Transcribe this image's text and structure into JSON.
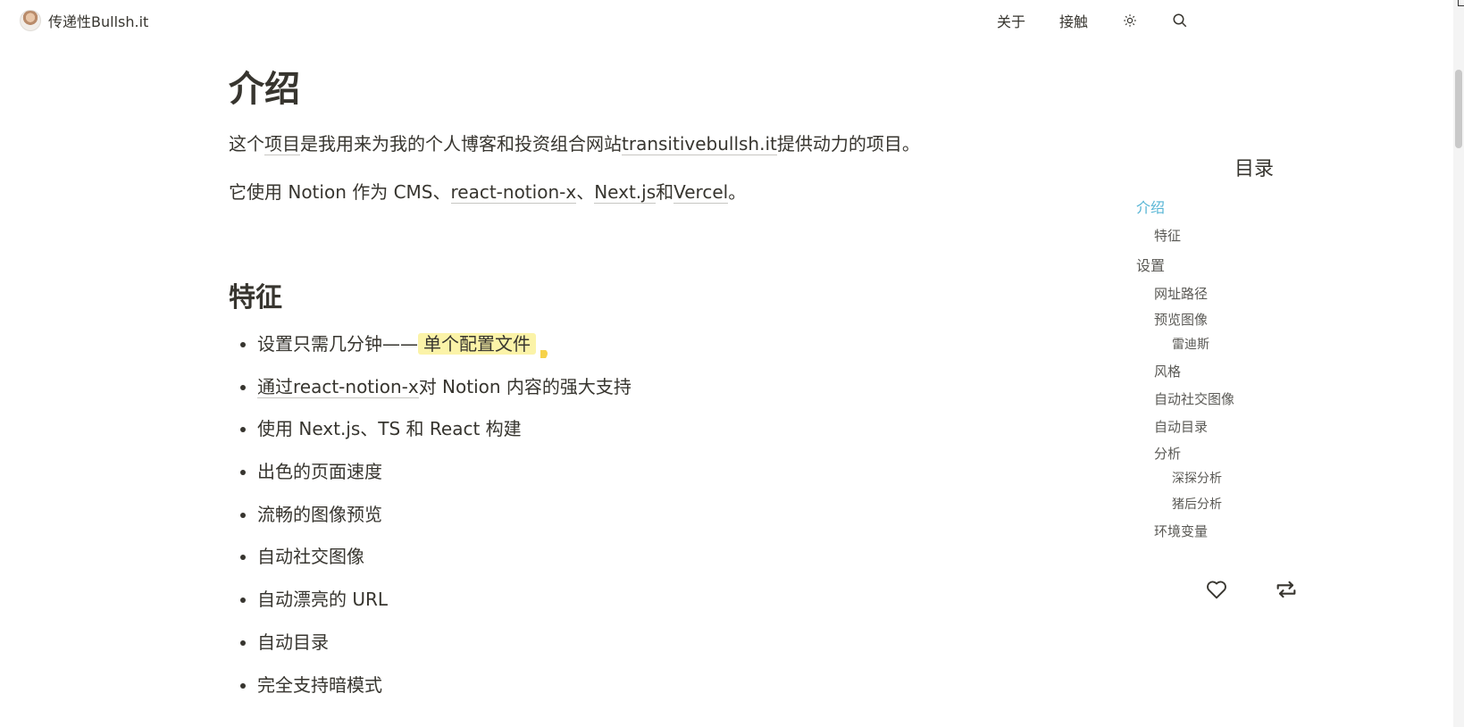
{
  "header": {
    "site_title": "传递性Bullsh.it",
    "nav": [
      {
        "label": "关于"
      },
      {
        "label": "接触"
      }
    ],
    "icons": {
      "theme": "sun-icon",
      "search": "search-icon"
    }
  },
  "main": {
    "title": "介绍",
    "intro": {
      "t1": "这个",
      "link1": "项目",
      "t2": "是我用来为我的个人博客和投资组合网站",
      "link2": "transitivebullsh.it",
      "t3": "提供动力的项目。"
    },
    "stack": {
      "t1": "它使用 Notion 作为 CMS、",
      "link1": "react-notion-x",
      "t2": "、",
      "link2": "Next.js",
      "t3": "和",
      "link3": "Vercel",
      "t4": "。"
    },
    "features_title": "特征",
    "features": {
      "f1_text": "设置只需几分钟——",
      "f1_highlight": "单个配置文件",
      "f2_link": "通过react-notion-x",
      "f2_text": "对 Notion 内容的强大支持",
      "f3": "使用 Next.js、TS 和 React 构建",
      "f4": "出色的页面速度",
      "f5": "流畅的图像预览",
      "f6": "自动社交图像",
      "f7": "自动漂亮的 URL",
      "f8": "自动目录",
      "f9": "完全支持暗模式"
    }
  },
  "toc": {
    "title": "目录",
    "items": [
      {
        "label": "介绍"
      },
      {
        "label": "特征"
      },
      {
        "label": "设置"
      },
      {
        "label": "网址路径"
      },
      {
        "label": "预览图像"
      },
      {
        "label": "雷迪斯"
      },
      {
        "label": "风格"
      },
      {
        "label": "自动社交图像"
      },
      {
        "label": "自动目录"
      },
      {
        "label": "分析"
      },
      {
        "label": "深探分析"
      },
      {
        "label": "猪后分析"
      },
      {
        "label": "环境变量"
      }
    ],
    "active_color": "#55b4d4"
  },
  "actions": {
    "like": "heart-icon",
    "repost": "repeat-icon"
  }
}
